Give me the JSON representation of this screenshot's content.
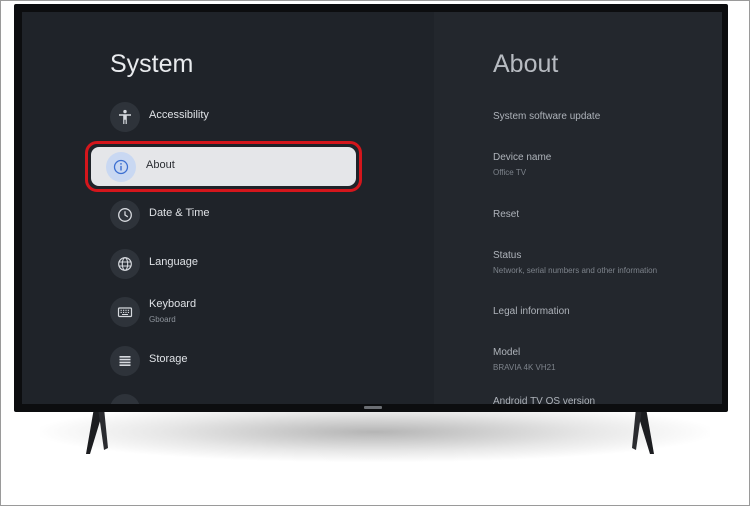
{
  "settings": {
    "title": "System",
    "items": [
      {
        "label": "Accessibility",
        "sublabel": "",
        "icon": "accessibility-icon"
      },
      {
        "label": "About",
        "sublabel": "",
        "icon": "info-icon",
        "selected": true
      },
      {
        "label": "Date & Time",
        "sublabel": "",
        "icon": "clock-icon"
      },
      {
        "label": "Language",
        "sublabel": "",
        "icon": "globe-icon"
      },
      {
        "label": "Keyboard",
        "sublabel": "Gboard",
        "icon": "keyboard-icon"
      },
      {
        "label": "Storage",
        "sublabel": "",
        "icon": "storage-icon"
      }
    ]
  },
  "about": {
    "title": "About",
    "items": [
      {
        "label": "System software update",
        "sublabel": ""
      },
      {
        "label": "Device name",
        "sublabel": "Office TV"
      },
      {
        "label": "Reset",
        "sublabel": ""
      },
      {
        "label": "Status",
        "sublabel": "Network, serial numbers and other information"
      },
      {
        "label": "Legal information",
        "sublabel": ""
      },
      {
        "label": "Model",
        "sublabel": "BRAVIA 4K VH21"
      },
      {
        "label": "Android TV OS version",
        "sublabel": ""
      }
    ]
  },
  "colors": {
    "highlight_border": "#d4161c",
    "selected_pill": "#e5e6e9",
    "screen_background": "#1f2329"
  }
}
